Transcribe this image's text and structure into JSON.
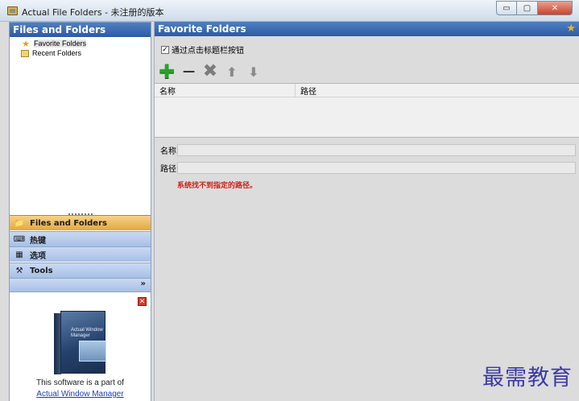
{
  "window": {
    "title": "Actual File Folders - 未注册的版本",
    "buttons": {
      "minimize": "▭",
      "maximize": "▢",
      "close": "✕"
    }
  },
  "left_panel": {
    "header": "Files and Folders",
    "tree": [
      {
        "label": "Favorite Folders",
        "icon": "star-icon"
      },
      {
        "label": "Recent Folders",
        "icon": "folder-icon"
      }
    ],
    "nav": [
      {
        "label": "Files and Folders",
        "icon": "files-folders-icon",
        "active": true
      },
      {
        "label": "热键",
        "icon": "keyboard-icon",
        "active": false
      },
      {
        "label": "选项",
        "icon": "options-icon",
        "active": false
      },
      {
        "label": "Tools",
        "icon": "tools-icon",
        "active": false
      }
    ],
    "nav_chevron": "»",
    "ad": {
      "close_icon": "✕",
      "product_box_text": "Actual Window Manager",
      "text": "This software is a part of",
      "link": "Actual Window Manager"
    }
  },
  "right_panel": {
    "header": "Favorite Folders",
    "checkbox_label": "通过点击标题栏按钮",
    "checkbox_checked": true,
    "toolbar": [
      "add",
      "remove",
      "delete",
      "move-up",
      "move-down"
    ],
    "list": {
      "columns": [
        "名称",
        "路径"
      ],
      "rows": []
    },
    "form": {
      "name_label": "名称",
      "name_value": "",
      "path_label": "路径",
      "path_value": ""
    },
    "error": "系统找不到指定的路径。"
  },
  "watermark": "最需教育",
  "colors": {
    "header_blue": "#2d5ba3",
    "active_nav": "#e3a83e",
    "error_red": "#d0211a"
  }
}
